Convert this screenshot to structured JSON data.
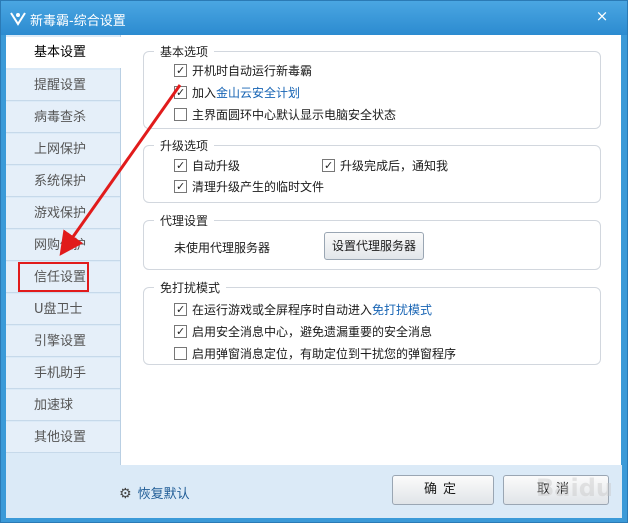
{
  "window": {
    "title": "新毒霸-综合设置",
    "close_label": "×"
  },
  "sidebar": {
    "items": [
      {
        "label": "基本设置"
      },
      {
        "label": "提醒设置"
      },
      {
        "label": "病毒查杀"
      },
      {
        "label": "上网保护"
      },
      {
        "label": "系统保护"
      },
      {
        "label": "游戏保护"
      },
      {
        "label": "网购保护"
      },
      {
        "label": "信任设置"
      },
      {
        "label": "U盘卫士"
      },
      {
        "label": "引擎设置"
      },
      {
        "label": "手机助手"
      },
      {
        "label": "加速球"
      },
      {
        "label": "其他设置"
      }
    ]
  },
  "basic": {
    "title": "基本选项",
    "opt1": "开机时自动运行新毒霸",
    "opt2_prefix": "加入",
    "opt2_link": "金山云安全计划",
    "opt3": "主界面圆环中心默认显示电脑安全状态"
  },
  "upgrade": {
    "title": "升级选项",
    "opt1": "自动升级",
    "opt2": "升级完成后，通知我",
    "opt3": "清理升级产生的临时文件"
  },
  "proxy": {
    "title": "代理设置",
    "status": "未使用代理服务器",
    "button": "设置代理服务器"
  },
  "nodisturb": {
    "title": "免打扰模式",
    "opt1_prefix": "在运行游戏或全屏程序时自动进入",
    "opt1_link": "免打扰模式",
    "opt2": "启用安全消息中心，避免遗漏重要的安全消息",
    "opt3": "启用弹窗消息定位，有助定位到干扰您的弹窗程序"
  },
  "footer": {
    "restore": "恢复默认",
    "ok": "确定",
    "cancel": "取消"
  },
  "watermark": "Baidu"
}
